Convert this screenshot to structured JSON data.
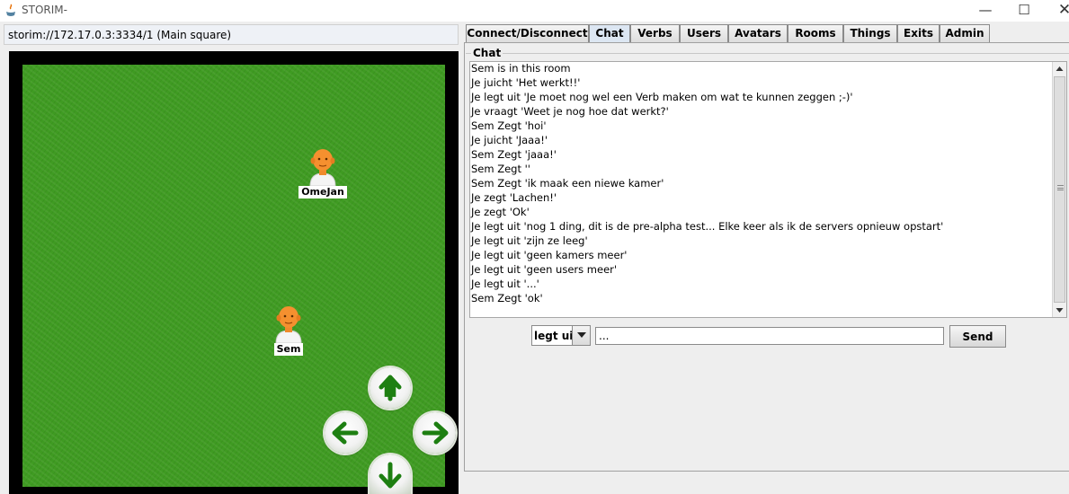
{
  "window": {
    "title": "STORIM-",
    "minimize_glyph": "—",
    "maximize_glyph": "☐",
    "close_glyph": "✕"
  },
  "address": {
    "value": "storim://172.17.0.3:3334/1 (Main square)"
  },
  "world": {
    "avatars": [
      {
        "name": "OmeJan",
        "icon": "person-avatar-icon"
      },
      {
        "name": "Sem",
        "icon": "person-avatar-icon"
      }
    ],
    "nav": [
      "arrow-up-icon",
      "arrow-left-icon",
      "arrow-right-icon",
      "arrow-down-icon"
    ],
    "colors": {
      "grass": "#3f9b22",
      "frame": "#000000",
      "arrow": "#1e7f12"
    }
  },
  "tabs": [
    {
      "label": "Connect/Disconnect",
      "active": false
    },
    {
      "label": "Chat",
      "active": true
    },
    {
      "label": "Verbs",
      "active": false
    },
    {
      "label": "Users",
      "active": false
    },
    {
      "label": "Avatars",
      "active": false
    },
    {
      "label": "Rooms",
      "active": false
    },
    {
      "label": "Things",
      "active": false
    },
    {
      "label": "Exits",
      "active": false
    },
    {
      "label": "Admin",
      "active": false
    }
  ],
  "chat": {
    "legend": "Chat",
    "lines": [
      "Sem is in this room",
      "Je juicht 'Het werkt!!'",
      "Je legt uit 'Je moet nog wel een Verb maken om wat te kunnen zeggen ;-)'",
      "Je vraagt 'Weet je nog hoe dat werkt?'",
      "Sem Zegt 'hoi'",
      "Je juicht 'Jaaa!'",
      "Sem Zegt 'jaaa!'",
      "Sem Zegt ''",
      "Sem Zegt 'ik maak een niewe kamer'",
      "Je zegt 'Lachen!'",
      "Je zegt 'Ok'",
      "Je legt uit 'nog 1 ding, dit is de pre-alpha test... Elke keer als ik de servers opnieuw opstart'",
      "Je legt uit 'zijn ze leeg'",
      "Je legt uit 'geen kamers meer'",
      "Je legt uit 'geen users meer'",
      "Je legt uit '...'",
      "Sem Zegt 'ok'"
    ]
  },
  "composer": {
    "verb": "legt uit",
    "message": "...",
    "send_label": "Send"
  }
}
